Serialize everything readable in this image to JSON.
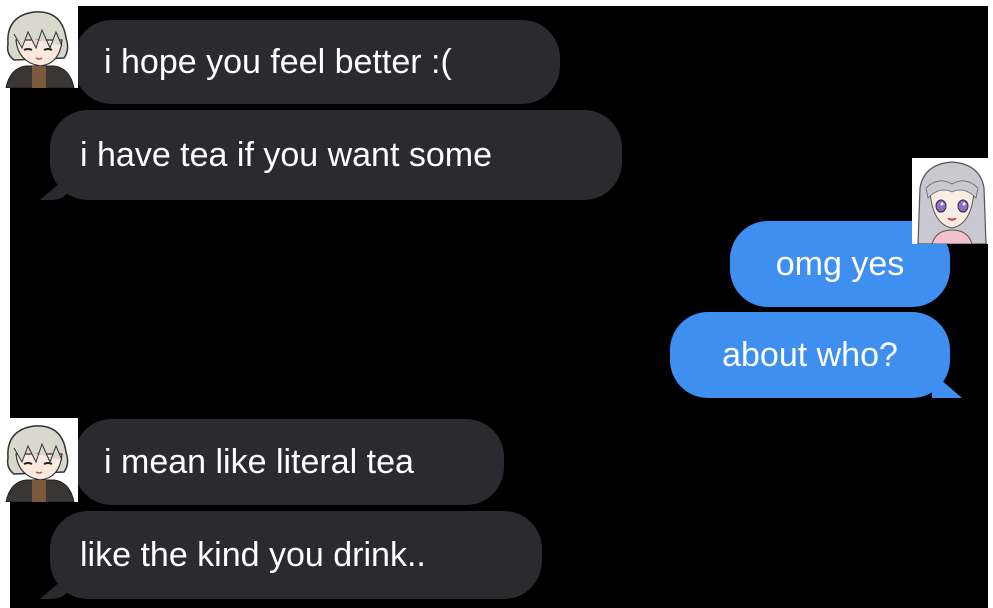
{
  "messages": {
    "incoming_1": "i hope you feel better :(",
    "incoming_2": "i have tea if you want some",
    "outgoing_1": "omg yes",
    "outgoing_2": "about who?",
    "incoming_3": "i mean like literal tea",
    "incoming_4": "like the kind you drink.."
  },
  "colors": {
    "background": "#000000",
    "incoming_bubble": "#2b2b2f",
    "outgoing_bubble": "#3f8ff0",
    "text": "#ffffff"
  },
  "icons": {
    "avatar_left": "anime-boy-avatar-icon",
    "avatar_right": "anime-girl-avatar-icon"
  }
}
